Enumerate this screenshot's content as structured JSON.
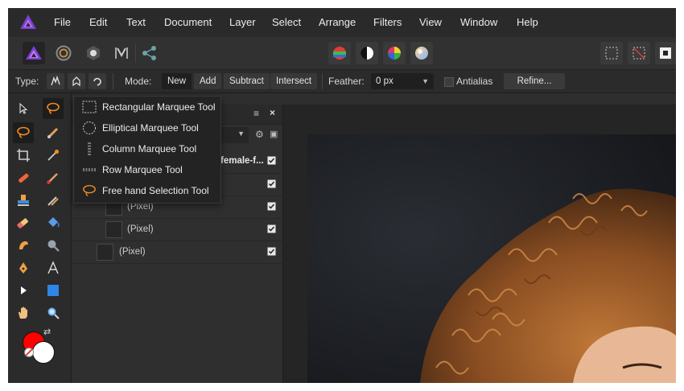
{
  "menu": [
    "File",
    "Edit",
    "Text",
    "Document",
    "Layer",
    "Select",
    "Arrange",
    "Filters",
    "View",
    "Window",
    "Help"
  ],
  "context_bar": {
    "type_label": "Type:",
    "mode_label": "Mode:",
    "modes": [
      "New",
      "Add",
      "Subtract",
      "Intersect"
    ],
    "selected_mode": "New",
    "feather_label": "Feather:",
    "feather_value": "0 px",
    "antialias_label": "Antialias",
    "refine_label": "Refine..."
  },
  "flyout": {
    "items": [
      {
        "label": "Rectangular Marquee Tool",
        "icon": "rect-marquee-icon"
      },
      {
        "label": "Elliptical Marquee Tool",
        "icon": "ellipse-marquee-icon"
      },
      {
        "label": "Column Marquee Tool",
        "icon": "column-marquee-icon"
      },
      {
        "label": "Row Marquee Tool",
        "icon": "row-marquee-icon"
      },
      {
        "label": "Free hand Selection Tool",
        "icon": "freehand-selection-icon"
      }
    ]
  },
  "layers": {
    "document_name_fragment": "female-f...",
    "rows": [
      "(Pixel)",
      "(Pixel)",
      "(Pixel)"
    ]
  },
  "colors": {
    "accent": "#f08a24",
    "primary_color": "#ff0000",
    "secondary_color": "#ffffff"
  }
}
